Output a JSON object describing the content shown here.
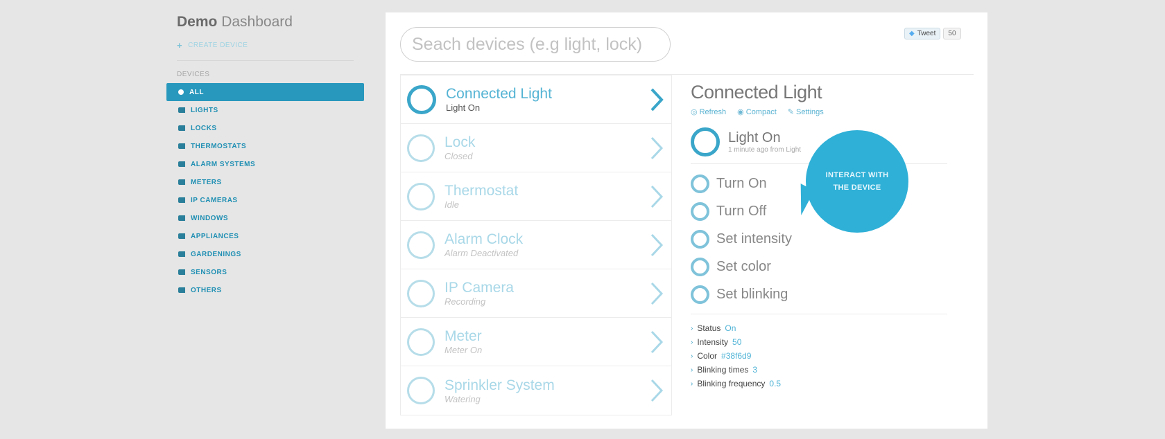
{
  "brand": {
    "bold": "Demo",
    "rest": " Dashboard"
  },
  "sidebar": {
    "create_label": "CREATE DEVICE",
    "section_heading": "DEVICES",
    "items": [
      {
        "label": "ALL",
        "active": true
      },
      {
        "label": "LIGHTS"
      },
      {
        "label": "LOCKS"
      },
      {
        "label": "THERMOSTATS"
      },
      {
        "label": "ALARM SYSTEMS"
      },
      {
        "label": "METERS"
      },
      {
        "label": "IP CAMERAS"
      },
      {
        "label": "WINDOWS"
      },
      {
        "label": "APPLIANCES"
      },
      {
        "label": "GARDENINGS"
      },
      {
        "label": "SENSORS"
      },
      {
        "label": "OTHERS"
      }
    ]
  },
  "search": {
    "placeholder": "Seach devices (e.g light, lock)"
  },
  "tweet": {
    "label": "Tweet",
    "count": "50"
  },
  "devices": [
    {
      "name": "Connected Light",
      "status": "Light On",
      "active": true
    },
    {
      "name": "Lock",
      "status": "Closed"
    },
    {
      "name": "Thermostat",
      "status": "Idle"
    },
    {
      "name": "Alarm Clock",
      "status": "Alarm Deactivated"
    },
    {
      "name": "IP Camera",
      "status": "Recording"
    },
    {
      "name": "Meter",
      "status": "Meter On"
    },
    {
      "name": "Sprinkler System",
      "status": "Watering"
    }
  ],
  "detail": {
    "title": "Connected Light",
    "links": [
      "Refresh",
      "Compact",
      "Settings"
    ],
    "state_name": "Light On",
    "state_sub": "1 minute ago from Light",
    "actions": [
      "Turn On",
      "Turn Off",
      "Set intensity",
      "Set color",
      "Set blinking"
    ],
    "props": [
      {
        "label": "Status",
        "value": "On"
      },
      {
        "label": "Intensity",
        "value": "50"
      },
      {
        "label": "Color",
        "value": "#38f6d9"
      },
      {
        "label": "Blinking times",
        "value": "3"
      },
      {
        "label": "Blinking frequency",
        "value": "0.5"
      }
    ]
  },
  "bubble": {
    "text": "INTERACT WITH THE DEVICE"
  },
  "colors": {
    "accent": "#2898bd",
    "bubble": "#2fb0d7",
    "ring": "#3aa6c9"
  }
}
